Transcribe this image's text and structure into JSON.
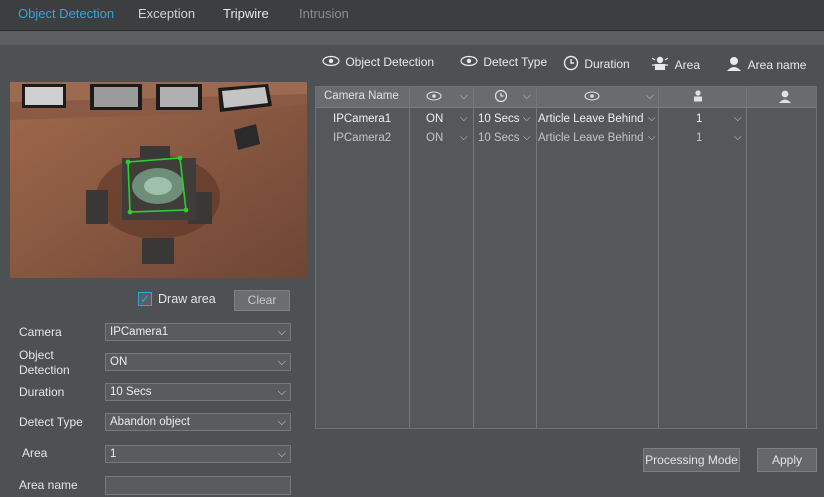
{
  "tabs": [
    "Object Detection",
    "Exception",
    "Tripwire",
    "Intrusion"
  ],
  "legend": {
    "object_detection": "Object Detection",
    "detect_type": "Detect Type",
    "duration": "Duration",
    "area": "Area",
    "area_name": "Area name"
  },
  "draw_area": {
    "label": "Draw  area",
    "checked": true
  },
  "clear_label": "Clear",
  "form": {
    "camera": {
      "label": "Camera",
      "value": "IPCamera1"
    },
    "object_detection": {
      "label_line1": "Object",
      "label_line2": "Detection",
      "value": "ON"
    },
    "duration": {
      "label": "Duration",
      "value": "10 Secs"
    },
    "detect_type": {
      "label": "Detect Type",
      "value": "Abandon object"
    },
    "area": {
      "label": "Area",
      "value": "1"
    },
    "area_name": {
      "label": "Area name",
      "value": ""
    }
  },
  "table": {
    "col_camera_name": "Camera Name",
    "rows": [
      {
        "camera": "IPCamera1",
        "detection": "ON",
        "duration": "10 Secs",
        "detect_type": "Article Leave Behind",
        "area": "1"
      },
      {
        "camera": "IPCamera2",
        "detection": "ON",
        "duration": "10 Secs",
        "detect_type": "Article Leave Behind",
        "area": "1"
      }
    ]
  },
  "buttons": {
    "processing_mode": "Processing Mode",
    "apply": "Apply"
  },
  "colors": {
    "accent": "#2fa8d8",
    "panel": "#4e5153",
    "detection_box": "#2bd02b"
  }
}
